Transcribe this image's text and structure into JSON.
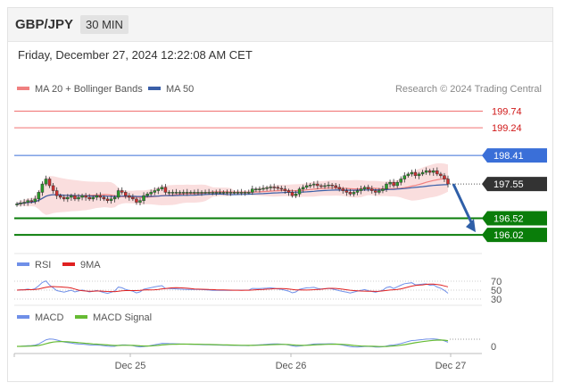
{
  "header": {
    "symbol": "GBP/JPY",
    "timeframe": "30 MIN",
    "datetime": "Friday, December 27, 2024 12:22:08 AM CET"
  },
  "legend": {
    "ma20": "MA 20 + Bollinger Bands",
    "ma50": "MA 50",
    "credit": "Research © 2024 Trading Central",
    "rsi": "RSI",
    "rsi_ma": "9MA",
    "macd": "MACD",
    "macd_signal": "MACD Signal"
  },
  "colors": {
    "ma20": "#f08080",
    "ma50": "#3a5fa8",
    "resistance": "#f07070",
    "resistance_label": "#d01818",
    "pivot": "#3a6fd8",
    "support": "#0a7d0a",
    "price": "#333333",
    "rsi": "#6f8fe8",
    "rsi_ma": "#e02020",
    "macd": "#6f8fe8",
    "macd_signal": "#66bb33",
    "arrow": "#2f5fa8"
  },
  "chart_data": [
    {
      "type": "candlestick",
      "panel": "price",
      "ylim": [
        195.7,
        200.05
      ],
      "x_ticks": [
        "Dec 25",
        "Dec 26",
        "Dec 27"
      ],
      "levels": [
        {
          "value": 199.74,
          "label": "199.74",
          "kind": "resistance"
        },
        {
          "value": 199.24,
          "label": "199.24",
          "kind": "resistance"
        },
        {
          "value": 198.41,
          "label": "198.41",
          "kind": "pivot"
        },
        {
          "value": 197.55,
          "label": "197.55",
          "kind": "last"
        },
        {
          "value": 196.52,
          "label": "196.52",
          "kind": "support"
        },
        {
          "value": 196.02,
          "label": "196.02",
          "kind": "support"
        }
      ],
      "close": [
        196.95,
        196.98,
        197.0,
        197.05,
        197.02,
        197.1,
        197.3,
        197.55,
        197.7,
        197.5,
        197.35,
        197.2,
        197.15,
        197.1,
        197.15,
        197.2,
        197.1,
        197.15,
        197.2,
        197.15,
        197.1,
        197.15,
        197.2,
        197.15,
        197.1,
        197.05,
        197.1,
        197.15,
        197.35,
        197.3,
        197.2,
        197.15,
        197.1,
        197.0,
        197.05,
        197.2,
        197.25,
        197.3,
        197.35,
        197.4,
        197.45,
        197.3,
        197.3,
        197.3,
        197.3,
        197.3,
        197.3,
        197.3,
        197.3,
        197.3,
        197.3,
        197.3,
        197.3,
        197.3,
        197.3,
        197.3,
        197.3,
        197.3,
        197.3,
        197.3,
        197.3,
        197.3,
        197.3,
        197.3,
        197.3,
        197.4,
        197.4,
        197.4,
        197.42,
        197.44,
        197.46,
        197.45,
        197.42,
        197.4,
        197.35,
        197.3,
        197.2,
        197.25,
        197.4,
        197.45,
        197.5,
        197.52,
        197.55,
        197.5,
        197.48,
        197.5,
        197.52,
        197.5,
        197.45,
        197.4,
        197.35,
        197.3,
        197.25,
        197.3,
        197.35,
        197.4,
        197.45,
        197.4,
        197.35,
        197.3,
        197.35,
        197.4,
        197.55,
        197.6,
        197.5,
        197.6,
        197.7,
        197.8,
        197.85,
        197.9,
        197.8,
        197.85,
        197.9,
        197.95,
        197.9,
        197.95,
        197.85,
        197.8,
        197.7,
        197.55
      ],
      "last": 197.55
    },
    {
      "type": "line",
      "panel": "rsi",
      "series": [
        {
          "name": "RSI"
        },
        {
          "name": "9MA"
        }
      ],
      "levels": [
        70,
        50,
        30
      ]
    },
    {
      "type": "line",
      "panel": "macd",
      "series": [
        {
          "name": "MACD"
        },
        {
          "name": "MACD Signal"
        }
      ],
      "levels": [
        0
      ]
    }
  ]
}
